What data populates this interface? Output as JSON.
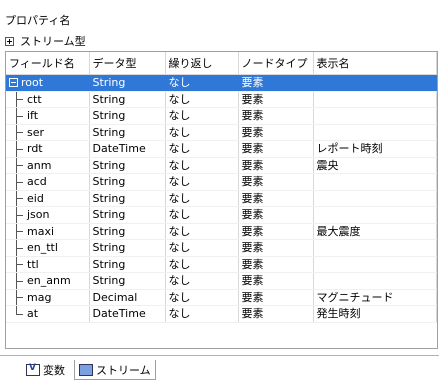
{
  "panel": {
    "title": "プロパティ名",
    "stream_label": "ストリーム型"
  },
  "columns": [
    "フィールド名",
    "データ型",
    "繰り返し",
    "ノードタイプ",
    "表示名"
  ],
  "rows": [
    {
      "name": "root",
      "type": "String",
      "repeat": "なし",
      "node": "要素",
      "display": ""
    },
    {
      "name": "ctt",
      "type": "String",
      "repeat": "なし",
      "node": "要素",
      "display": ""
    },
    {
      "name": "ift",
      "type": "String",
      "repeat": "なし",
      "node": "要素",
      "display": ""
    },
    {
      "name": "ser",
      "type": "String",
      "repeat": "なし",
      "node": "要素",
      "display": ""
    },
    {
      "name": "rdt",
      "type": "DateTime",
      "repeat": "なし",
      "node": "要素",
      "display": "レポート時刻"
    },
    {
      "name": "anm",
      "type": "String",
      "repeat": "なし",
      "node": "要素",
      "display": "震央"
    },
    {
      "name": "acd",
      "type": "String",
      "repeat": "なし",
      "node": "要素",
      "display": ""
    },
    {
      "name": "eid",
      "type": "String",
      "repeat": "なし",
      "node": "要素",
      "display": ""
    },
    {
      "name": "json",
      "type": "String",
      "repeat": "なし",
      "node": "要素",
      "display": ""
    },
    {
      "name": "maxi",
      "type": "String",
      "repeat": "なし",
      "node": "要素",
      "display": "最大震度"
    },
    {
      "name": "en_ttl",
      "type": "String",
      "repeat": "なし",
      "node": "要素",
      "display": ""
    },
    {
      "name": "ttl",
      "type": "String",
      "repeat": "なし",
      "node": "要素",
      "display": ""
    },
    {
      "name": "en_anm",
      "type": "String",
      "repeat": "なし",
      "node": "要素",
      "display": ""
    },
    {
      "name": "mag",
      "type": "Decimal",
      "repeat": "なし",
      "node": "要素",
      "display": "マグニチュード"
    },
    {
      "name": "at",
      "type": "DateTime",
      "repeat": "なし",
      "node": "要素",
      "display": "発生時刻"
    }
  ],
  "tabs": [
    {
      "label": "変数",
      "icon": "variables-icon",
      "active": false
    },
    {
      "label": "ストリーム",
      "icon": "stream-icon",
      "active": true
    }
  ],
  "colors": {
    "selection": "#3078d8"
  }
}
